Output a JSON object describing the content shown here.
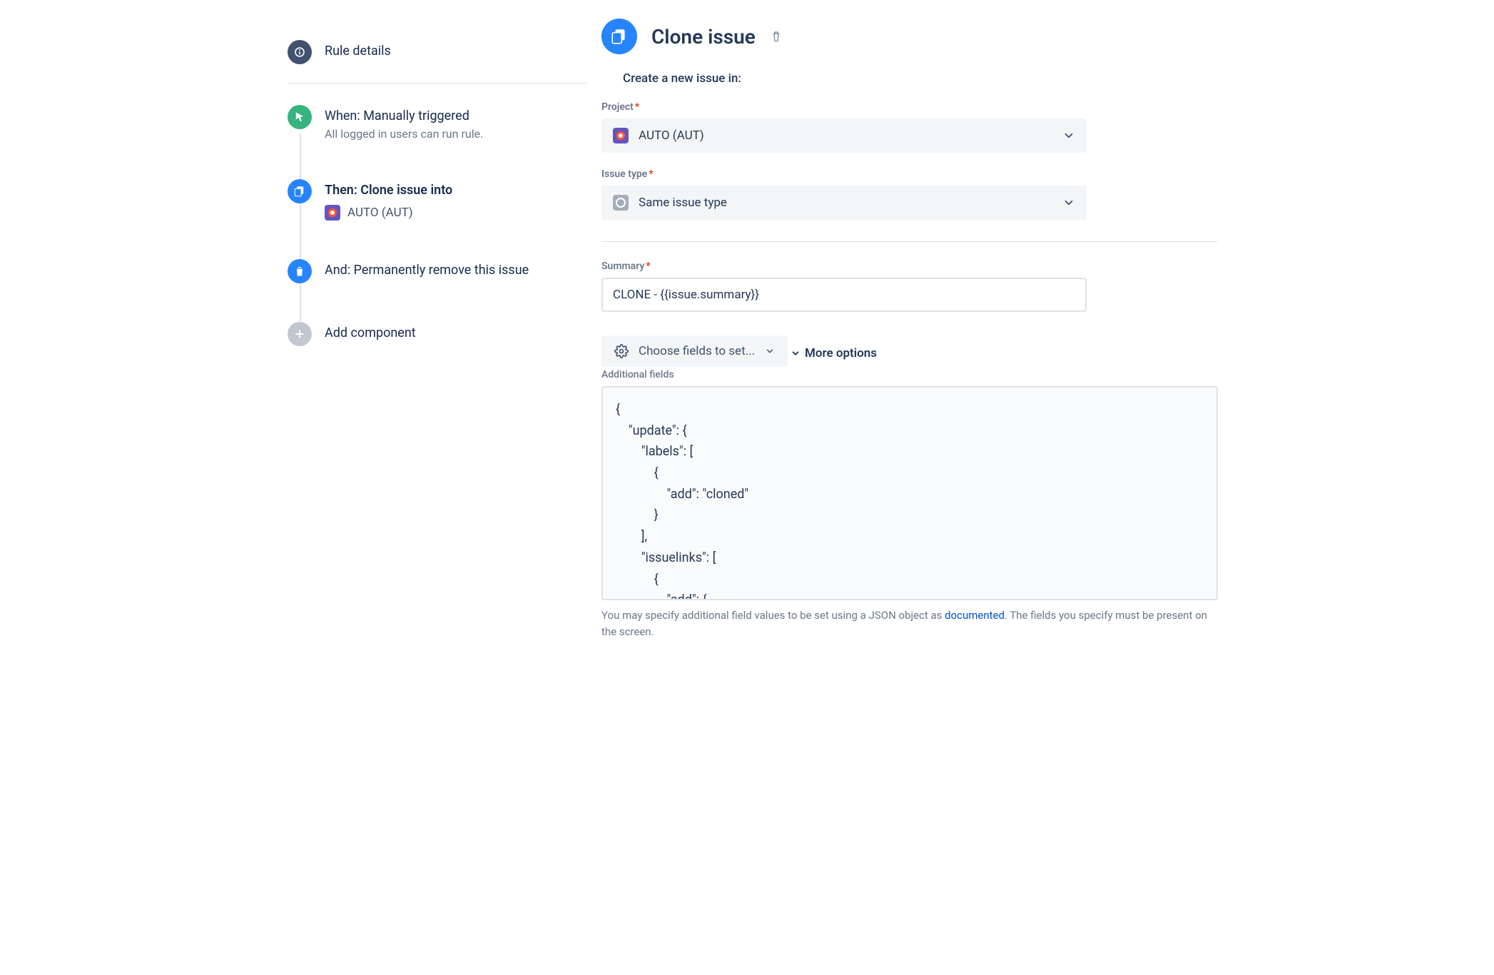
{
  "sidebar": {
    "rule_details": "Rule details",
    "when": {
      "title": "When: Manually triggered",
      "sub": "All logged in users can run rule."
    },
    "then": {
      "title": "Then: Clone issue into",
      "project": "AUTO (AUT)"
    },
    "and": {
      "title": "And: Permanently remove this issue"
    },
    "add": "Add component"
  },
  "header": {
    "title": "Clone issue",
    "subtitle": "Create a new issue in:"
  },
  "fields": {
    "project_label": "Project",
    "project_value": "AUTO (AUT)",
    "issuetype_label": "Issue type",
    "issuetype_value": "Same issue type",
    "summary_label": "Summary",
    "summary_value": "CLONE - {{issue.summary}}",
    "choose_fields": "Choose fields to set...",
    "more_options": "More options",
    "additional_label": "Additional fields",
    "additional_value": "{\n    \"update\": {\n        \"labels\": [\n            {\n                \"add\": \"cloned\"\n            }\n        ],\n        \"issuelinks\": [\n            {\n                \"add\": {",
    "help_pre": "You may specify additional field values to be set using a JSON object as ",
    "help_link": "documented",
    "help_post": ". The fields you specify must be present on the screen."
  }
}
